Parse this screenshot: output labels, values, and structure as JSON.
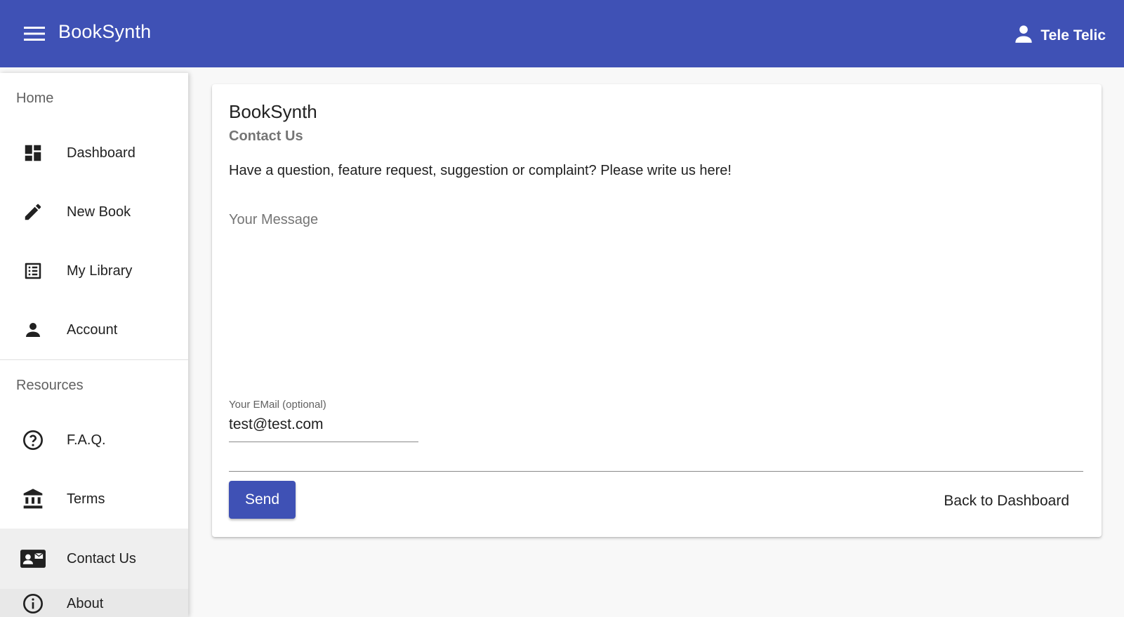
{
  "topbar": {
    "app_title": "BookSynth",
    "user_name": "Tele Telic",
    "menu_icon": "menu-icon",
    "user_icon": "person-icon",
    "color": "#3f51b5"
  },
  "sidebar": {
    "sections": [
      {
        "header": "Home",
        "items": [
          {
            "label": "Dashboard",
            "icon": "dashboard-icon"
          },
          {
            "label": "New Book",
            "icon": "pencil-icon"
          },
          {
            "label": "My Library",
            "icon": "list-icon"
          },
          {
            "label": "Account",
            "icon": "person-icon"
          }
        ]
      },
      {
        "header": "Resources",
        "items": [
          {
            "label": "F.A.Q.",
            "icon": "help-circle-icon"
          },
          {
            "label": "Terms",
            "icon": "bank-icon"
          },
          {
            "label": "Contact Us",
            "icon": "contact-mail-icon"
          },
          {
            "label": "About",
            "icon": "info-icon"
          }
        ]
      }
    ]
  },
  "card": {
    "title": "BookSynth",
    "subtitle": "Contact Us",
    "text": "Have a question, feature request, suggestion or complaint? Please write us here!",
    "message_placeholder": "Your Message",
    "email_label": "Your EMail (optional)",
    "email_value": "test@test.com",
    "send_label": "Send",
    "back_label": "Back to Dashboard"
  }
}
